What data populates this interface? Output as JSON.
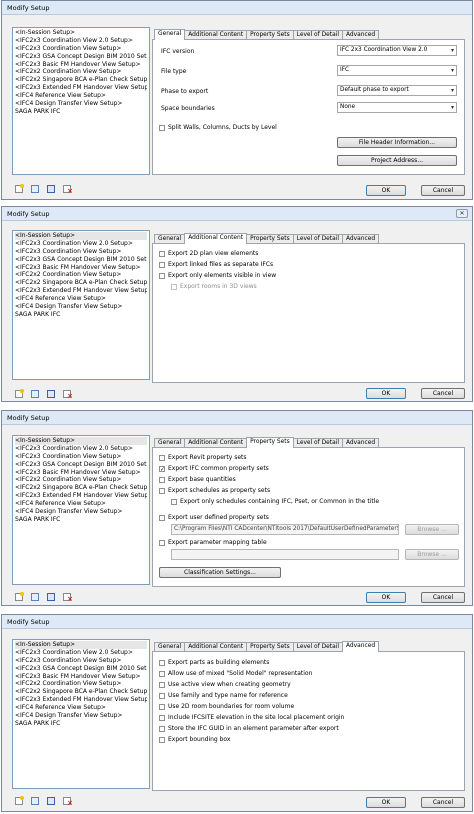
{
  "dialog_title": "Modify Setup",
  "setups": [
    "<In-Session Setup>",
    "<IFC2x3 Coordination View 2.0 Setup>",
    "<IFC2x3 Coordination View Setup>",
    "<IFC2x3 GSA Concept Design BIM 2010 Setup>",
    "<IFC2x3 Basic FM Handover View Setup>",
    "<IFC2x2 Coordination View Setup>",
    "<IFC2x2 Singapore BCA e-Plan Check Setup>",
    "<IFC2x3 Extended FM Handover View Setup>",
    "<IFC4 Reference View Setup>",
    "<IFC4 Design Transfer View Setup>",
    "SAGA PARK IFC"
  ],
  "tabs": [
    "General",
    "Additional Content",
    "Property Sets",
    "Level of Detail",
    "Advanced"
  ],
  "buttons": {
    "ok": "OK",
    "cancel": "Cancel"
  },
  "general": {
    "ifc_version_label": "IFC version",
    "ifc_version_value": "IFC 2x3 Coordination View 2.0",
    "file_type_label": "File type",
    "file_type_value": "IFC",
    "phase_label": "Phase to export",
    "phase_value": "Default phase to export",
    "space_label": "Space boundaries",
    "space_value": "None",
    "split_walls": "Split Walls, Columns, Ducts by Level",
    "file_header_btn": "File Header Information...",
    "project_address_btn": "Project Address..."
  },
  "additional": [
    "Export 2D plan view elements",
    "Export linked files as separate IFCs",
    "Export only elements visible in view",
    "Export rooms in 3D views"
  ],
  "propsets": {
    "items": [
      "Export Revit property sets",
      "Export IFC common property sets",
      "Export base quantities",
      "Export schedules as property sets",
      "Export only schedules containing IFC, Pset, or Common in the title",
      "Export user defined property sets",
      "Export parameter mapping table"
    ],
    "user_path": "C:\\Program Files\\NTI CADcenter\\NTItools 2017\\DefaultUserDefinedParameterSets",
    "browse": "Browse ...",
    "classification_btn": "Classification Settings..."
  },
  "advanced": [
    "Export parts as building elements",
    "Allow use of mixed \"Solid Model\" representation",
    "Use active view when creating geometry",
    "Use family and type name for reference",
    "Use 2D room boundaries for room volume",
    "Include IFCSITE elevation in the site local placement origin",
    "Store the IFC GUID in an element parameter after export",
    "Export bounding box"
  ]
}
